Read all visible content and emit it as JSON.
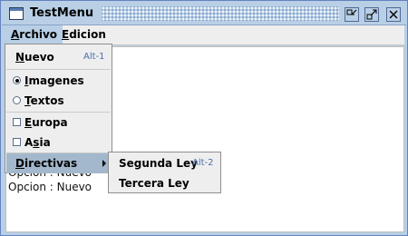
{
  "window": {
    "title": "TestMenu",
    "minimize_glyph": "▫↙",
    "maximize_glyph": "↗",
    "close_glyph": "✕"
  },
  "menubar": {
    "items": [
      {
        "label": "Archivo",
        "mnemonic": "A",
        "rest": "rchivo"
      },
      {
        "label": "Edicion",
        "mnemonic": "E",
        "rest": "dicion"
      }
    ]
  },
  "content": {
    "log_lines": [
      "Opcion : Nuevo",
      "Opcion : Nuevo"
    ]
  },
  "archivo_menu": {
    "nuevo": {
      "mnemonic": "N",
      "rest": "uevo",
      "accelerator": "Alt-1"
    },
    "imagenes": {
      "mnemonic": "I",
      "rest": "magenes",
      "selected": true
    },
    "textos": {
      "mnemonic": "T",
      "rest": "extos",
      "selected": false
    },
    "europa": {
      "mnemonic": "E",
      "rest": "uropa",
      "checked": false
    },
    "asia": {
      "pre": "A",
      "mnemonic": "s",
      "rest": "ia",
      "checked": false
    },
    "directivas": {
      "mnemonic": "D",
      "rest": "irectivas"
    }
  },
  "directivas_submenu": {
    "segunda_ley": {
      "label": "Segunda Ley",
      "accelerator": "Alt-2"
    },
    "tercera_ley": {
      "label": "Tercera Ley"
    }
  },
  "colors": {
    "title_bar": "#b8cfe5",
    "armed_item": "#a3b8cc",
    "accelerator_text": "#4b6ea8"
  }
}
